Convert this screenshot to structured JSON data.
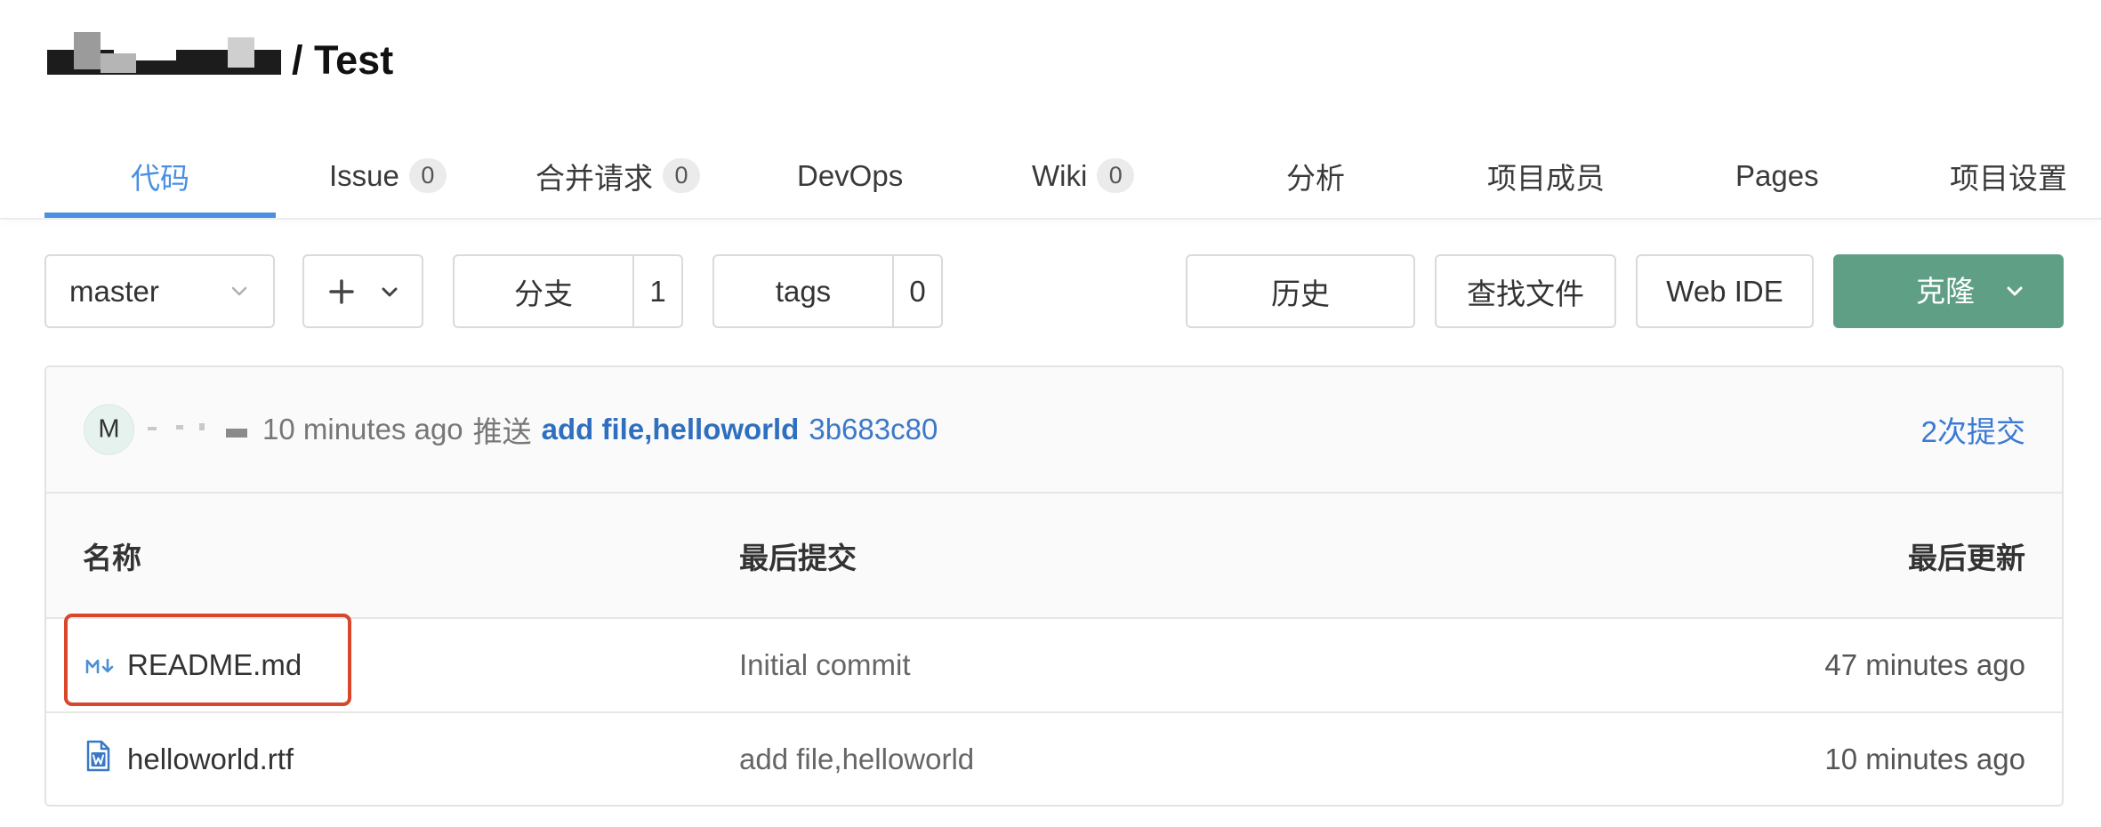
{
  "project": {
    "title": "/ Test"
  },
  "tabs": [
    {
      "label": "代码",
      "active": true
    },
    {
      "label": "Issue",
      "badge": "0"
    },
    {
      "label": "合并请求",
      "badge": "0"
    },
    {
      "label": "DevOps"
    },
    {
      "label": "Wiki",
      "badge": "0"
    },
    {
      "label": "分析"
    },
    {
      "label": "项目成员"
    },
    {
      "label": "Pages"
    },
    {
      "label": "项目设置"
    }
  ],
  "toolbar": {
    "branch_select": {
      "value": "master",
      "icon": "chevron-down-icon"
    },
    "add_menu": {
      "icon": "plus-icon",
      "caret": "chevron-down-icon"
    },
    "branches": {
      "label": "分支",
      "count": "1"
    },
    "tags": {
      "label": "tags",
      "count": "0"
    },
    "history_label": "历史",
    "find_file_label": "查找文件",
    "web_ide_label": "Web IDE",
    "clone_label": "克隆",
    "clone_caret": "chevron-down-icon"
  },
  "last_commit": {
    "avatar_initial": "M",
    "time": "10 minutes ago",
    "action": "推送",
    "message": "add file,helloworld",
    "sha": "3b683c80",
    "commit_count_link": "2次提交"
  },
  "table": {
    "columns": {
      "name": "名称",
      "last_commit": "最后提交",
      "last_update": "最后更新"
    },
    "rows": [
      {
        "name": "README.md",
        "icon": "markdown-file-icon",
        "last_commit": "Initial commit",
        "updated": "47 minutes ago",
        "highlighted": true
      },
      {
        "name": "helloworld.rtf",
        "icon": "word-document-icon",
        "last_commit": "add file,helloworld",
        "updated": "10 minutes ago",
        "highlighted": false
      }
    ]
  },
  "colors": {
    "accent": "#4a90e2",
    "link": "#2f6fbf",
    "clone_button": "#5f9f86",
    "highlight_box": "#d9462c"
  }
}
